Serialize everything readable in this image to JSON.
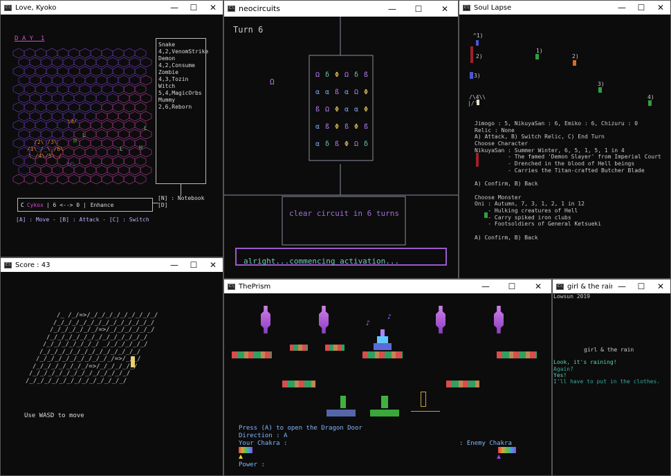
{
  "windows": {
    "love": {
      "title": "Love, Kyoko",
      "day": "D A Y  1",
      "sidebar": [
        "Snake",
        "4,2,VenomStrike",
        "Demon",
        "4,2,Consume",
        "Zombie",
        "4,3,Tozin",
        "Witch",
        "5,4,MagicOrbs",
        "Mummy",
        "2,6,Reborn"
      ],
      "notebook": "[N] : Notebook",
      "d_key": "[D]",
      "status_c": "C",
      "status_name": "Cykox",
      "status_mid": "| 6 <--> 0 |",
      "status_action": "Enhance",
      "controls": "[A] : Move - [B] : Attack - [C] : Switch",
      "map_chars": [
        "\\d/",
        "/2\\ /3\\",
        "/1\\_/_\\_/6\\",
        "\\_/4\\/5\\_/",
        "\\/\\",
        "ℍ",
        "L",
        "L",
        "L",
        "ℍ"
      ]
    },
    "neo": {
      "title": "neocircuits",
      "turn": "Turn 6",
      "omega": "Ω",
      "grid": [
        [
          "Ω",
          "δ",
          "Φ",
          "Ω",
          "δ",
          "ß"
        ],
        [
          "α",
          "α",
          "ß",
          "α",
          "Ω",
          "Φ"
        ],
        [
          "ß",
          "Ω",
          "Φ",
          "α",
          "α",
          "Φ"
        ],
        [
          "α",
          "ß",
          "Φ",
          "ß",
          "Φ",
          "ß"
        ],
        [
          "α",
          "δ",
          "ß",
          "Φ",
          "Ω",
          "δ"
        ]
      ],
      "grid_colors": [
        [
          "#b37feb",
          "#68c8a8",
          "#e8c860",
          "#b37feb",
          "#68c8a8",
          "#b37feb"
        ],
        [
          "#7faaff",
          "#7faaff",
          "#b37feb",
          "#7faaff",
          "#b37feb",
          "#e8c860"
        ],
        [
          "#b37feb",
          "#b37feb",
          "#e8c860",
          "#7faaff",
          "#7faaff",
          "#e8c860"
        ],
        [
          "#7faaff",
          "#b37feb",
          "#e8c860",
          "#b37feb",
          "#e8c860",
          "#b37feb"
        ],
        [
          "#7faaff",
          "#68c8a8",
          "#b37feb",
          "#e8c860",
          "#b37feb",
          "#68c8a8"
        ]
      ],
      "objective": "clear circuit in 6 turns",
      "message": "alright...commencing activation..."
    },
    "soul": {
      "title": "Soul Lapse",
      "labels": [
        "^1)",
        "2)",
        "3)",
        "1)",
        "2)",
        "3)",
        "4)"
      ],
      "art": "/\\4\\\\",
      "art2": "|/'",
      "lines": [
        "Jimogo : 5, NikuyaSan : 6, Emiko : 6, Chizuru : 0",
        "Relic : None",
        "A) Attack, B) Switch Relic, C) End Turn",
        "Choose Character",
        "NikuyaSan : Summer Winter, 6, 5, 1, 5, 1 in 4",
        "          - The famed 'Demon Slayer' from Imperial Court",
        "          - Drenched in the blood of Hell beings",
        "          - Carries the Titan-crafted Butcher Blade",
        "",
        "A) Confirm, B) Back",
        "",
        "Choose Monster",
        "Oni : Autumn, 7, 3, 1, 2, 1 in 12",
        "    - Hulking creatures of Hell",
        "    - Carry spiked iron clubs",
        "    - Footsoldiers of General Ketsueki",
        "",
        "A) Confirm, B) Back"
      ]
    },
    "score": {
      "title": "Score : 43",
      "rows": [
        "/_ /_/=>/_/_/_/_/_/_/_/_/_/",
        "/_/_/_/_/_/_/_/_/_/_/_/_/_/",
        "/_/_/_/_/_/_/=>/_/_/_/_/_/_/",
        "/_/_/_/_/_/_/_/_/_/_/_/_/_/",
        "/_/_/_/_/_/_/_/ _/_/_/_/_/_/",
        "/_/_/_/_/_/_/_/_/_/_/_/_/_/",
        "/_/_/_/_/_/_/_/_/_/_/=>/_/_/",
        "/_/_/_/_/_/_/_/=>/_/_/_/_/_/",
        "/_/_/_/_/_/_/_/_/_/_/_/_/_/",
        "/_/_/_/_/_/_/_/_/_/_/_/_/_/"
      ],
      "hint": "Use WASD to move"
    },
    "prism": {
      "title": "ThePrism",
      "line1": "Press (A) to open the Dragon Door",
      "line2": "Direction : A",
      "chakra_you": "Your Chakra :",
      "chakra_enemy": ": Enemy Chakra",
      "power": "Power :",
      "notes": [
        "♪",
        "♪"
      ]
    },
    "rain": {
      "title": "girl & the rain",
      "credit": "Lowsun 2019",
      "heading": "girl & the rain",
      "line1": "Look, it's raining!",
      "line2": "Again?",
      "line3": "Yes!",
      "line4": "I'll have to put in the clothes."
    }
  },
  "window_controls": {
    "minimize": "—",
    "maximize": "☐",
    "close": "✕"
  },
  "colors": {
    "accent_purple": "#9b59d0",
    "teal": "#5fd7af",
    "pink": "#d24dcf",
    "cyan_text": "#7fb8ff"
  }
}
